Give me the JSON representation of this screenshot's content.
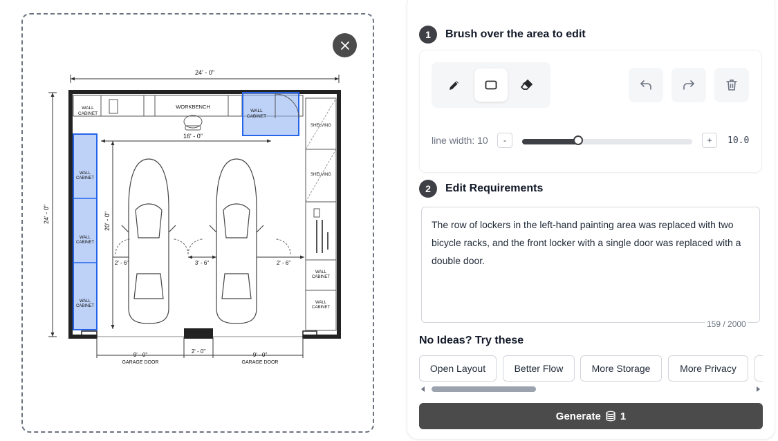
{
  "plan": {
    "overall_width": "24' - 0\"",
    "overall_depth": "24' - 0\"",
    "workbench_label": "WORKBENCH",
    "wall_cabinet_label": [
      "WALL",
      "CABINET"
    ],
    "shelving_label": "SHELVING",
    "inner_width": "16' - 0\"",
    "inner_depth": "20' - 0\"",
    "clear_left": "2' - 6\"",
    "clear_middle": "3' - 6\"",
    "clear_right": "2' - 6\"",
    "door_width": "9' - 0\"",
    "pier_width": "2' - 0\"",
    "garage_door_label": "GARAGE DOOR",
    "selection_color": "#2563eb"
  },
  "step1": {
    "number": "1",
    "title": "Brush over the area to edit"
  },
  "tools": {
    "items": [
      "pencil-icon",
      "rectangle-icon",
      "eraser-icon"
    ],
    "active": "rectangle-icon",
    "actions": [
      "undo-icon",
      "redo-icon",
      "trash-icon"
    ]
  },
  "line_width": {
    "label": "line width: 10",
    "decrement": "-",
    "increment": "+",
    "value_text": "10.0",
    "fraction": 0.33
  },
  "step2": {
    "number": "2",
    "title": "Edit Requirements"
  },
  "requirements": {
    "text": "The row of lockers in the left-hand painting area was replaced with two bicycle racks, and the front locker with a single door was replaced with a double door.",
    "char_count": "159 / 2000"
  },
  "ideas": {
    "title": "No Ideas? Try these",
    "chips": [
      "Open Layout",
      "Better Flow",
      "More Storage",
      "More Privacy"
    ]
  },
  "generate": {
    "label": "Generate",
    "cost": "1"
  }
}
